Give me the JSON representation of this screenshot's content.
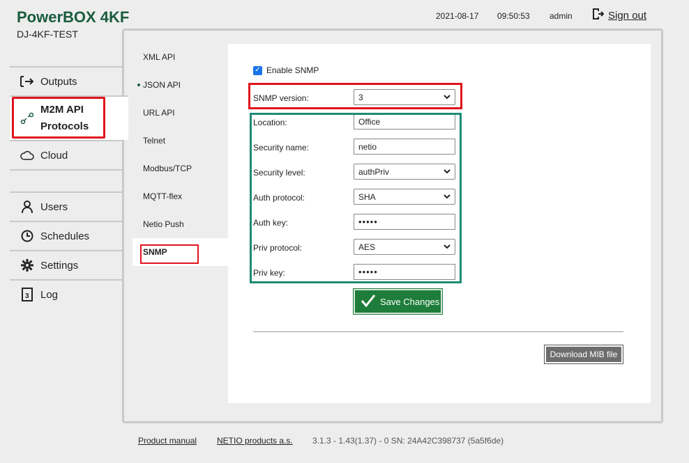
{
  "header": {
    "brand": "PowerBOX 4KF",
    "device_name": "DJ-4KF-TEST",
    "date": "2021-08-17",
    "time": "09:50:53",
    "user": "admin",
    "sign_out_label": "Sign out"
  },
  "sidebar": {
    "items": [
      {
        "label": "Outputs",
        "icon": "outputs-icon"
      },
      {
        "label": "M2M API Protocols",
        "label_line1": "M2M API",
        "label_line2": "Protocols",
        "icon": "m2m-icon",
        "active": true
      },
      {
        "label": "Cloud",
        "icon": "cloud-icon"
      },
      {
        "label": "Users",
        "icon": "user-icon"
      },
      {
        "label": "Schedules",
        "icon": "clock-icon"
      },
      {
        "label": "Settings",
        "icon": "gear-icon"
      },
      {
        "label": "Log",
        "icon": "log-icon"
      }
    ]
  },
  "subnav": {
    "items": [
      {
        "label": "XML API"
      },
      {
        "label": "JSON API",
        "enabled_dot": true
      },
      {
        "label": "URL API"
      },
      {
        "label": "Telnet"
      },
      {
        "label": "Modbus/TCP"
      },
      {
        "label": "MQTT-flex"
      },
      {
        "label": "Netio Push"
      },
      {
        "label": "SNMP",
        "active": true
      }
    ]
  },
  "snmp": {
    "enable_label": "Enable SNMP",
    "enabled": true,
    "version_label": "SNMP version:",
    "version_value": "3",
    "location_label": "Location:",
    "location_value": "Office",
    "security_name_label": "Security name:",
    "security_name_value": "netio",
    "security_level_label": "Security level:",
    "security_level_value": "authPriv",
    "auth_protocol_label": "Auth protocol:",
    "auth_protocol_value": "SHA",
    "auth_key_label": "Auth key:",
    "auth_key_value": "•••••",
    "priv_protocol_label": "Priv protocol:",
    "priv_protocol_value": "AES",
    "priv_key_label": "Priv key:",
    "priv_key_value": "•••••",
    "save_label": "Save Changes",
    "download_label": "Download MIB file"
  },
  "footer": {
    "manual_label": "Product manual",
    "company_label": "NETIO products a.s.",
    "version_text": "3.1.3 - 1.43(1.37) - 0 SN: 24A42C398737 (5a5f6de)"
  },
  "colors": {
    "brand_green": "#1a5c3f",
    "highlight_red": "#e0141e",
    "highlight_teal": "#1f8a75",
    "save_green": "#1e7d3a"
  }
}
